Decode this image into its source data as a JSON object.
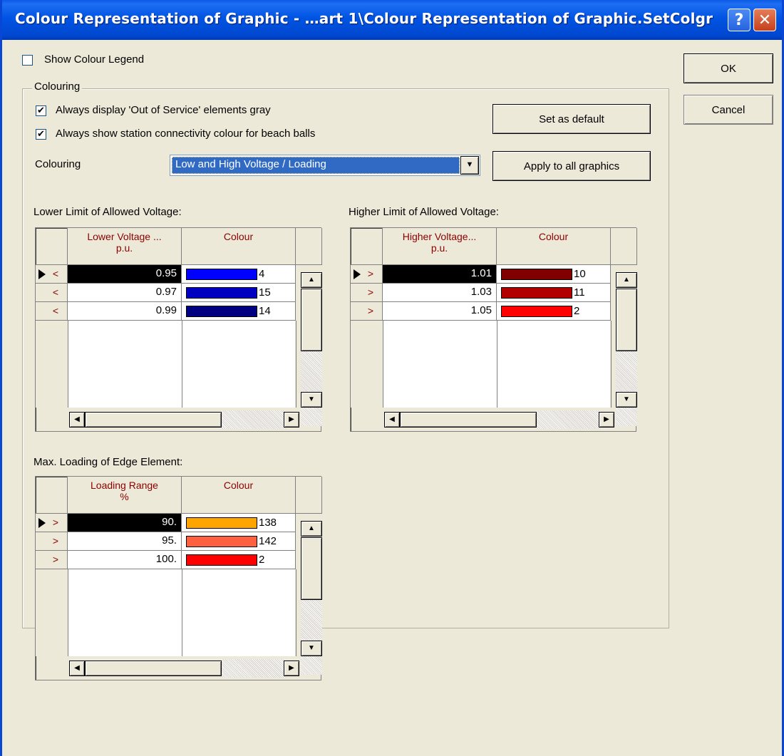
{
  "title": "Colour Representation of Graphic - …art 1\\Colour Representation of Graphic.SetColgr",
  "titlebar_buttons": {
    "help": "?",
    "close": "✕"
  },
  "show_legend": {
    "label": "Show Colour Legend",
    "checked": false
  },
  "buttons": {
    "ok": "OK",
    "cancel": "Cancel",
    "set_default": "Set as default",
    "apply_all": "Apply to all graphics"
  },
  "colouring_group": {
    "title": "Colouring",
    "opt_out_of_service": {
      "label": "Always display 'Out of Service' elements gray",
      "checked": true,
      "mark": "✔"
    },
    "opt_beach_balls": {
      "label": "Always show station connectivity colour for beach balls",
      "checked": true,
      "mark": "✔"
    },
    "colouring_label": "Colouring",
    "colouring_value": "Low and High Voltage / Loading"
  },
  "tables": {
    "lower": {
      "title": "Lower Limit of Allowed Voltage:",
      "col1_line1": "Lower Voltage ...",
      "col1_line2": "p.u.",
      "col2": "Colour",
      "rows": [
        {
          "sym": "<",
          "value": "0.95",
          "color": "#0000FF",
          "num": "4"
        },
        {
          "sym": "<",
          "value": "0.97",
          "color": "#0000C0",
          "num": "15"
        },
        {
          "sym": "<",
          "value": "0.99",
          "color": "#000080",
          "num": "14"
        }
      ]
    },
    "higher": {
      "title": "Higher Limit of Allowed Voltage:",
      "col1_line1": "Higher Voltage...",
      "col1_line2": "p.u.",
      "col2": "Colour",
      "rows": [
        {
          "sym": ">",
          "value": "1.01",
          "color": "#800000",
          "num": "10"
        },
        {
          "sym": ">",
          "value": "1.03",
          "color": "#B00000",
          "num": "11"
        },
        {
          "sym": ">",
          "value": "1.05",
          "color": "#FF0000",
          "num": "2"
        }
      ]
    },
    "loading": {
      "title": "Max. Loading of Edge Element:",
      "col1_line1": "Loading Range",
      "col1_line2": "%",
      "col2": "Colour",
      "rows": [
        {
          "sym": ">",
          "value": "90.",
          "color": "#FFA500",
          "num": "138"
        },
        {
          "sym": ">",
          "value": "95.",
          "color": "#FF6040",
          "num": "142"
        },
        {
          "sym": ">",
          "value": "100.",
          "color": "#FF0000",
          "num": "2"
        }
      ]
    }
  },
  "scroll_glyphs": {
    "up": "▲",
    "down": "▼",
    "left": "◀",
    "right": "▶",
    "combo": "▼"
  }
}
